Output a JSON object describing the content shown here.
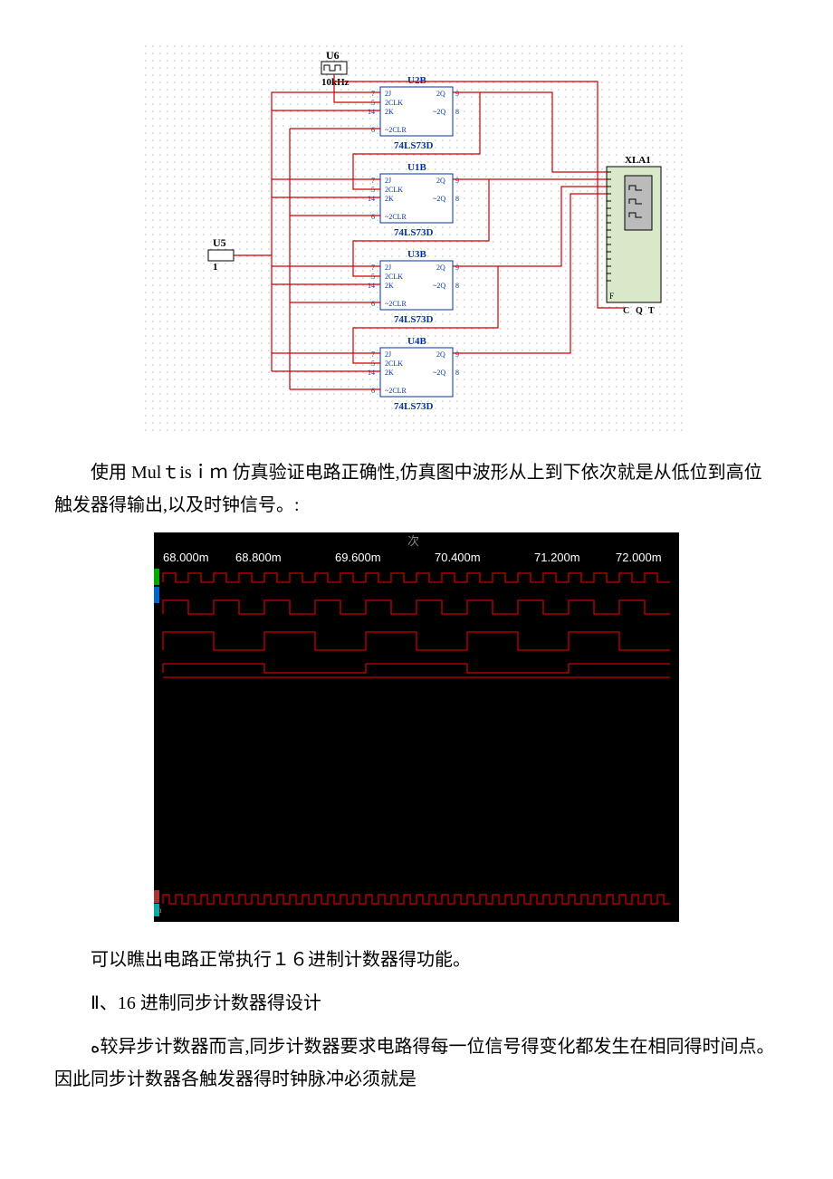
{
  "circuit": {
    "clock": {
      "name": "U6",
      "icon": "⎍⎍",
      "freq": "10kHz"
    },
    "vcc": {
      "name": "U5",
      "value": "1"
    },
    "flipflops": [
      {
        "name": "U2B",
        "part": "74LS73D"
      },
      {
        "name": "U1B",
        "part": "74LS73D"
      },
      {
        "name": "U3B",
        "part": "74LS73D"
      },
      {
        "name": "U4B",
        "part": "74LS73D"
      }
    ],
    "pins": {
      "p7": "7",
      "p5": "5",
      "p14": "14",
      "p6": "6",
      "p9": "9",
      "p8": "8",
      "j": "2J",
      "clk": "2CLK",
      "k": "2K",
      "clr": "~2CLR",
      "q": "2Q",
      "nq": "~2Q"
    },
    "analyzer": {
      "name": "XLA1",
      "labels": [
        "F",
        "C",
        "Q",
        "T"
      ]
    }
  },
  "paragraphs": {
    "p1": "使用 Mulｔisｉｍ 仿真验证电路正确性,仿真图中波形从上到下依次就是从低位到高位触发器得输出,以及时钟信号。:",
    "wave_title": "次",
    "wave_ticks": [
      "68.000m",
      "68.800m",
      "69.600m",
      "70.400m",
      "71.200m",
      "72.000m"
    ],
    "p2": "可以瞧出电路正常执行１６进制计数器得功能。",
    "p3": "Ⅱ、16 进制同步计数器得设计",
    "p4": "ﻩ较异步计数器而言,同步计数器要求电路得每一位信号得变化都发生在相同得时间点。因此同步计数器各触发器得时钟脉冲必须就是"
  }
}
